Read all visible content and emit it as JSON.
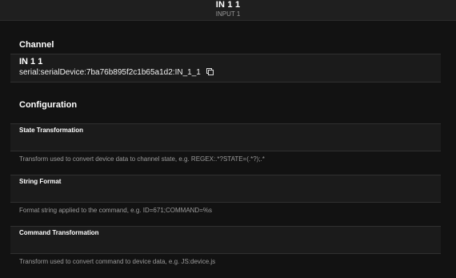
{
  "header": {
    "title": "IN 1 1",
    "subtitle": "INPUT 1"
  },
  "channel": {
    "section_title": "Channel",
    "name": "IN 1 1",
    "uid": "serial:serialDevice:7ba76b895f2c1b65a1d2:IN_1_1",
    "copy_icon": "copy-icon"
  },
  "configuration": {
    "section_title": "Configuration",
    "fields": [
      {
        "label": "State Transformation",
        "value": "",
        "hint": "Transform used to convert device data to channel state, e.g. REGEX:.*?STATE=(.*?);.*"
      },
      {
        "label": "String Format",
        "value": "",
        "hint": "Format string applied to the command, e.g. ID=671;COMMAND=%s"
      },
      {
        "label": "Command Transformation",
        "value": "",
        "hint": "Transform used to convert command to device data, e.g. JS:device.js"
      }
    ]
  }
}
